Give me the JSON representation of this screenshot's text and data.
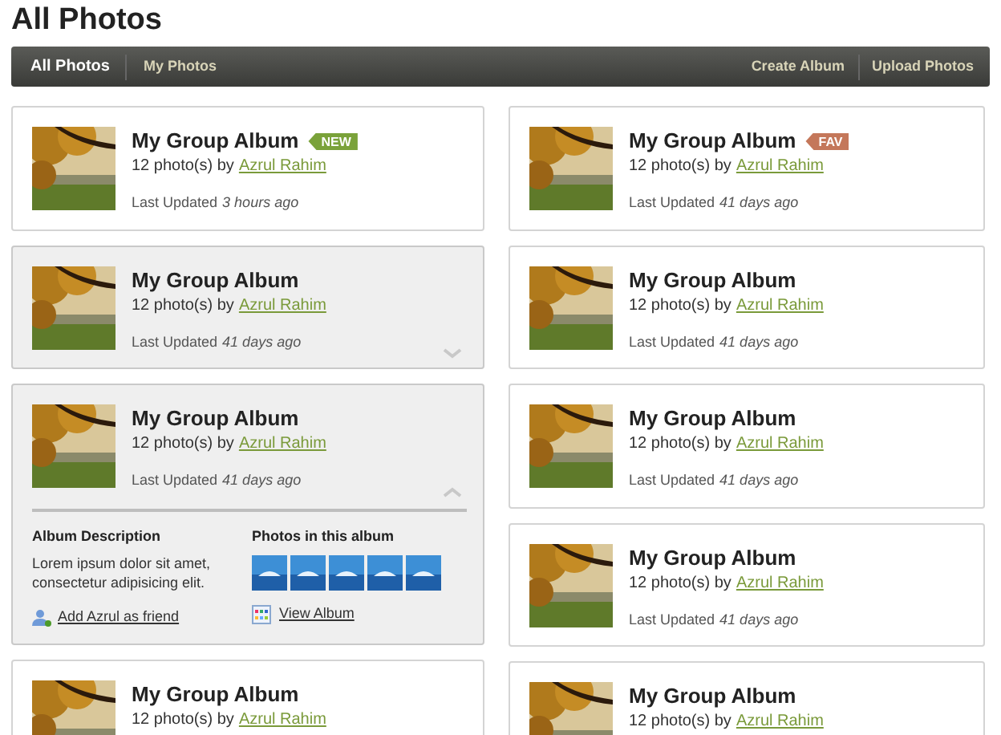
{
  "page_title": "All Photos",
  "nav": {
    "tabs": [
      {
        "label": "All Photos",
        "selected": true
      },
      {
        "label": "My Photos",
        "selected": false
      }
    ],
    "actions": [
      "Create Album",
      "Upload Photos"
    ]
  },
  "columns": [
    {
      "albums": [
        {
          "title": "My Group Album",
          "count": "12 photo(s) by",
          "author": "Azrul Rahim",
          "updated_label": "Last Updated",
          "updated_ago": "3 hours ago",
          "badge": {
            "text": "NEW",
            "kind": "new"
          },
          "highlighted": false
        },
        {
          "title": "My Group Album",
          "count": "12 photo(s) by",
          "author": "Azrul Rahim",
          "updated_label": "Last Updated",
          "updated_ago": "41 days ago",
          "highlighted": true,
          "expanded": false
        },
        {
          "title": "My Group Album",
          "count": "12 photo(s) by",
          "author": "Azrul Rahim",
          "updated_label": "Last Updated",
          "updated_ago": "41 days ago",
          "highlighted": true,
          "expanded": true,
          "details": {
            "description_heading": "Album Description",
            "description": "Lorem ipsum dolor sit amet, consectetur adipisicing elit.",
            "photos_heading": "Photos in this album",
            "photos": [
              {
                "kind": "photo"
              },
              {
                "kind": "photo"
              },
              {
                "kind": "photo"
              },
              {
                "kind": "photo"
              },
              {
                "kind": "photo"
              }
            ],
            "friend_link": "Add Azrul as friend",
            "view_link": "View Album"
          }
        },
        {
          "title": "My Group Album",
          "count": "12 photo(s) by",
          "author": "Azrul Rahim",
          "highlighted": false
        }
      ]
    },
    {
      "albums": [
        {
          "title": "My Group Album",
          "count": "12 photo(s) by",
          "author": "Azrul Rahim",
          "updated_label": "Last Updated",
          "updated_ago": "41 days ago",
          "badge": {
            "text": "FAV",
            "kind": "fav"
          },
          "highlighted": false
        },
        {
          "title": "My Group Album",
          "count": "12 photo(s) by",
          "author": "Azrul Rahim",
          "updated_label": "Last Updated",
          "updated_ago": "41 days ago",
          "highlighted": false
        },
        {
          "title": "My Group Album",
          "count": "12 photo(s) by",
          "author": "Azrul Rahim",
          "updated_label": "Last Updated",
          "updated_ago": "41 days ago",
          "highlighted": false
        },
        {
          "title": "My Group Album",
          "count": "12 photo(s) by",
          "author": "Azrul Rahim",
          "updated_label": "Last Updated",
          "updated_ago": "41 days ago",
          "highlighted": false
        },
        {
          "title": "My Group Album",
          "count": "12 photo(s) by",
          "author": "Azrul Rahim",
          "highlighted": false
        }
      ]
    }
  ]
}
